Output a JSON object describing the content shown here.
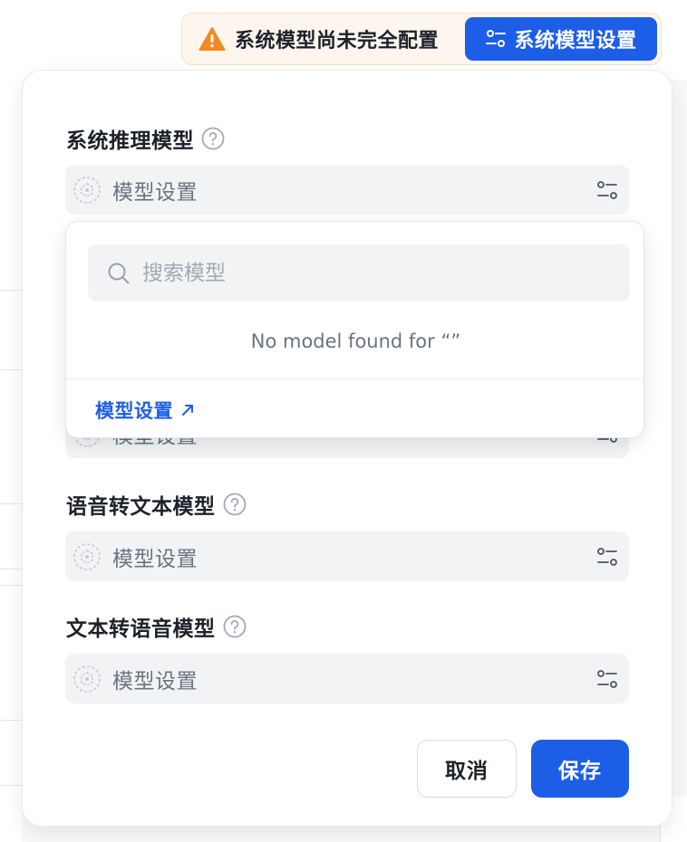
{
  "notice": {
    "warning_text": "系统模型尚未完全配置",
    "settings_button_label": "系统模型设置"
  },
  "modal": {
    "fields": [
      {
        "label": "系统推理模型",
        "value": "模型设置"
      },
      {
        "label": "",
        "value": "模型设置"
      },
      {
        "label": "语音转文本模型",
        "value": "模型设置"
      },
      {
        "label": "文本转语音模型",
        "value": "模型设置"
      }
    ],
    "dropdown": {
      "search_placeholder": "搜索模型",
      "search_value": "",
      "empty_message": "No model found for “”",
      "link_label": "模型设置"
    },
    "cancel_label": "取消",
    "save_label": "保存"
  },
  "colors": {
    "primary": "#1d5ee6",
    "warning": "#f08a24",
    "field_bg": "#f2f3f5"
  }
}
